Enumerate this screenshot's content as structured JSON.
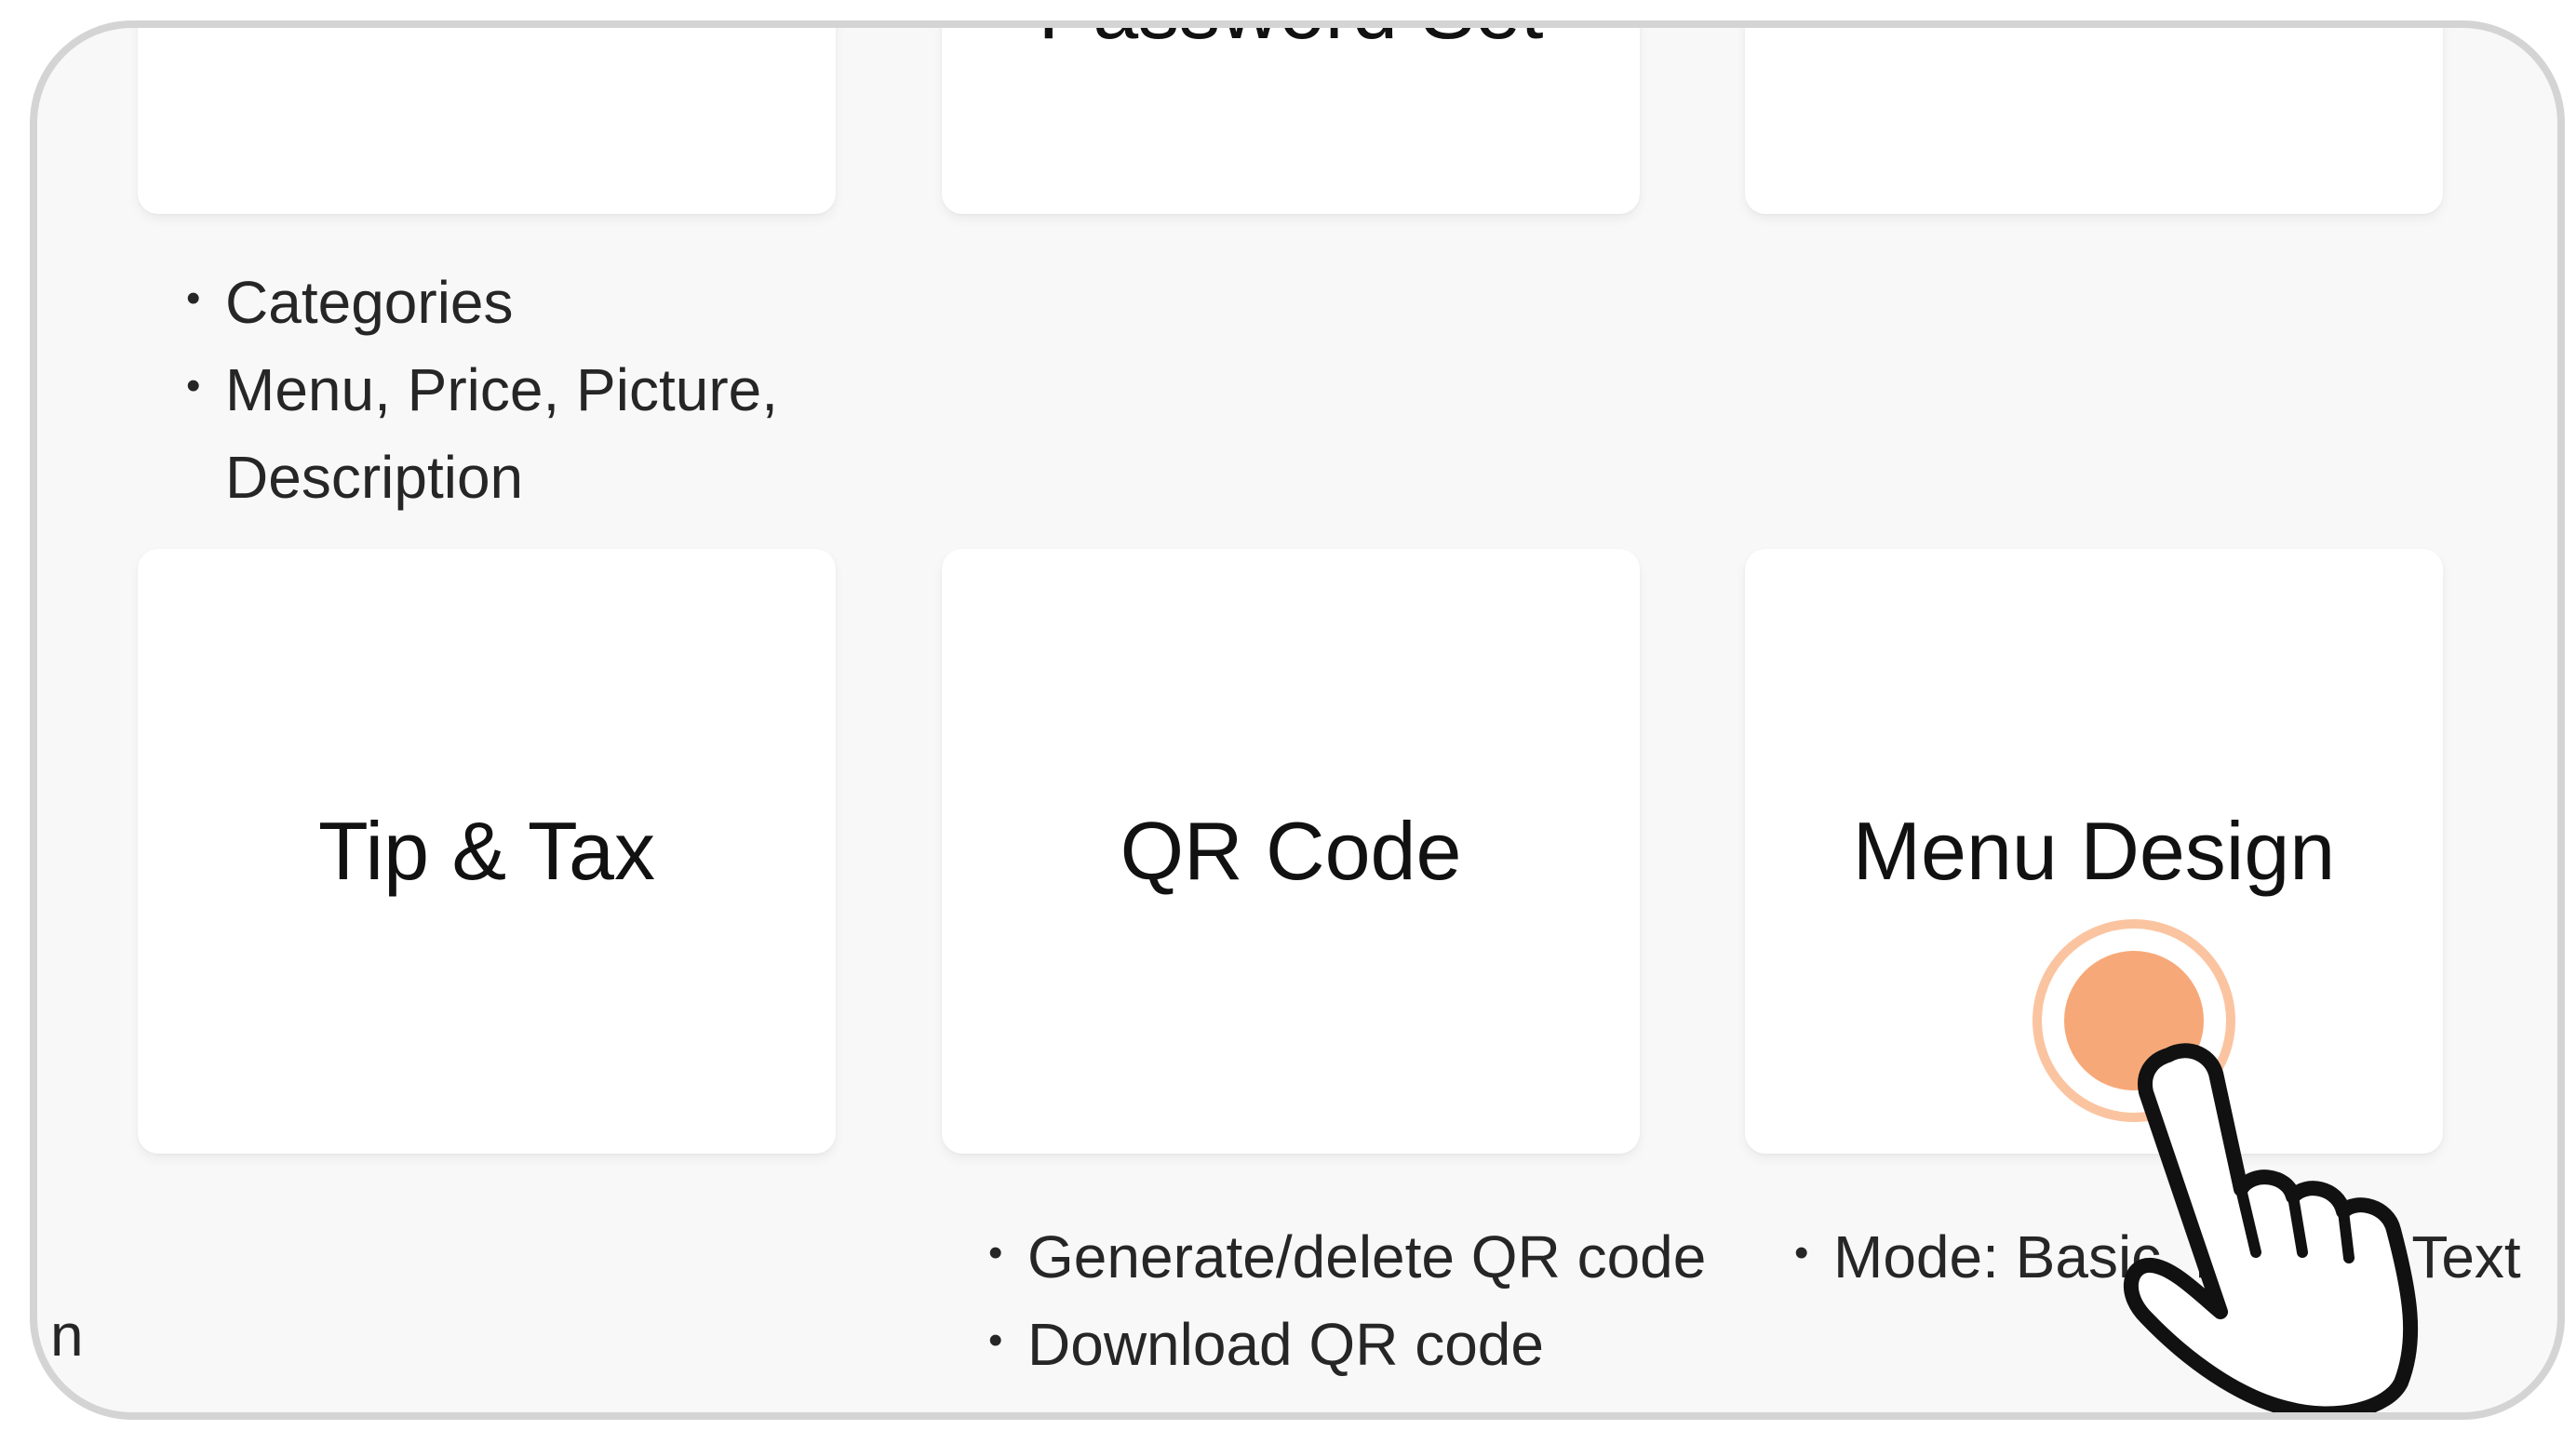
{
  "accent_color": "#f7a878",
  "top_cards": [
    {
      "title": ""
    },
    {
      "title": "Password Set"
    },
    {
      "title": ""
    }
  ],
  "menu_bullets": [
    "Categories",
    "Menu, Price, Picture, Description"
  ],
  "bottom_cards": [
    {
      "title": "Tip & Tax"
    },
    {
      "title": "QR Code"
    },
    {
      "title": "Menu Design"
    }
  ],
  "qr_bullets": [
    "Generate/delete QR code",
    "Download QR code"
  ],
  "design_bullets": [
    "Mode: Basic, Picture, Text"
  ],
  "edge_text": "n",
  "tap_indicator": {
    "icon": "tap-hand-icon",
    "target": "Menu Design"
  }
}
